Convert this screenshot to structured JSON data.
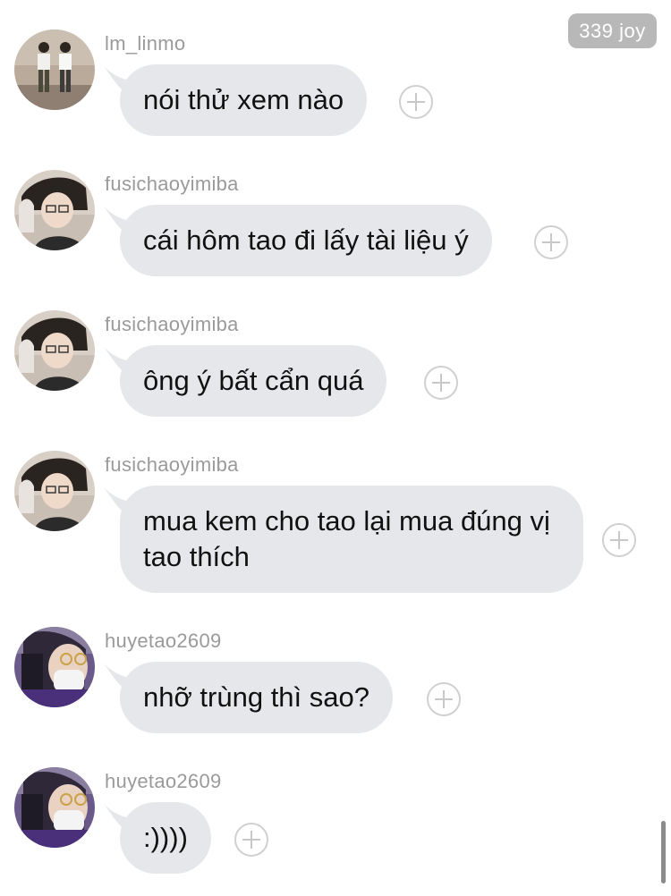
{
  "badge": {
    "label": "339 joy"
  },
  "messages": [
    {
      "username": "lm_linmo",
      "text": "nói thử xem nào",
      "avatar_icon": "avatar-two-people-icon"
    },
    {
      "username": "fusichaoyimiba",
      "text": "cái hôm tao đi lấy tài liệu ý",
      "avatar_icon": "avatar-boy-glasses-icon"
    },
    {
      "username": "fusichaoyimiba",
      "text": "ông ý bất cẩn quá",
      "avatar_icon": "avatar-boy-glasses-icon"
    },
    {
      "username": "fusichaoyimiba",
      "text": "mua kem cho tao lại mua đúng vị tao thích",
      "avatar_icon": "avatar-boy-glasses-icon"
    },
    {
      "username": "huyetao2609",
      "text": "nhỡ trùng thì sao?",
      "avatar_icon": "avatar-masked-person-icon"
    },
    {
      "username": "huyetao2609",
      "text": ":))))",
      "avatar_icon": "avatar-masked-person-icon"
    }
  ],
  "colors": {
    "bubble": "#e5e7ea",
    "username": "#9a9a9a",
    "badge": "#b8b8b8"
  }
}
